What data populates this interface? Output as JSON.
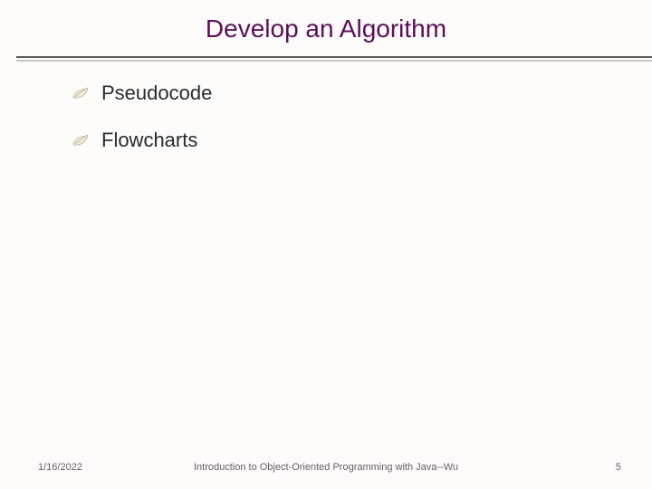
{
  "title": "Develop an Algorithm",
  "bullets": [
    {
      "label": "Pseudocode"
    },
    {
      "label": "Flowcharts"
    }
  ],
  "footer": {
    "date": "1/16/2022",
    "center": "Introduction to Object-Oriented Programming with Java--Wu",
    "page": "5"
  }
}
